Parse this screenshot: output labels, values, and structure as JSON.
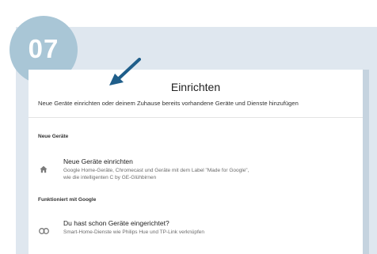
{
  "step": {
    "number": "07"
  },
  "dialog": {
    "title": "Einrichten",
    "subtitle": "Neue Geräte einrichten oder deinem Zuhause bereits vorhandene Geräte und Dienste hinzufügen"
  },
  "sections": [
    {
      "heading": "Neue Geräte",
      "item": {
        "icon": "home-icon",
        "title": "Neue Geräte einrichten",
        "desc_line1": "Google Home-Geräte, Chromecast und Geräte mit dem Label \"Made for Google\",",
        "desc_line2": "wie die intelligenten C by GE-Glühbirnen"
      }
    },
    {
      "heading": "Funktioniert mit Google",
      "item": {
        "icon": "link-icon",
        "title": "Du hast schon Geräte eingerichtet?",
        "desc_line1": "Smart-Home-Dienste wie Philips Hue und TP-Link verknüpfen"
      }
    }
  ],
  "colors": {
    "step_circle": "#a9c6d6",
    "frame_bg": "#dfe7ef",
    "arrow": "#1f5e8a"
  }
}
